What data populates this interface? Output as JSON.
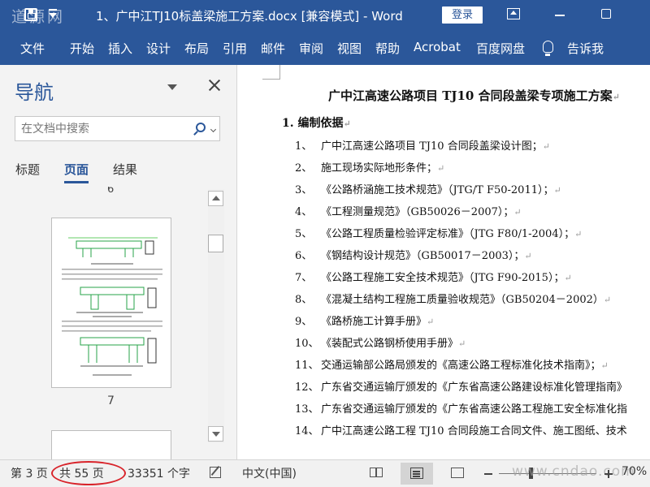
{
  "window": {
    "watermark": "道源网",
    "title": "1、广中江TJ10标盖梁施工方案.docx [兼容模式]  -  Word",
    "login_label": "登录"
  },
  "ribbon": {
    "tabs": [
      "文件",
      "开始",
      "插入",
      "设计",
      "布局",
      "引用",
      "邮件",
      "审阅",
      "视图",
      "帮助",
      "Acrobat",
      "百度网盘"
    ],
    "tell_me": "告诉我"
  },
  "nav": {
    "title": "导航",
    "search_placeholder": "在文档中搜索",
    "tabs": [
      "标题",
      "页面",
      "结果"
    ],
    "active_tab": "页面",
    "page_above": "6",
    "page_label": "7"
  },
  "document": {
    "title": "广中江高速公路项目 TJ10 合同段盖梁专项施工方案",
    "heading": "1. 编制依据",
    "items": [
      {
        "num": "1、",
        "text": "广中江高速公路项目 TJ10 合同段盖梁设计图；"
      },
      {
        "num": "2、",
        "text": "施工现场实际地形条件；"
      },
      {
        "num": "3、",
        "text": "《公路桥涵施工技术规范》（JTG/T F50-2011）；"
      },
      {
        "num": "4、",
        "text": "《工程测量规范》（GB50026－2007）；"
      },
      {
        "num": "5、",
        "text": "《公路工程质量检验评定标准》（JTG F80/1-2004）；"
      },
      {
        "num": "6、",
        "text": "《钢结构设计规范》（GB50017－2003）；"
      },
      {
        "num": "7、",
        "text": "《公路工程施工安全技术规范》（JTG F90-2015）；"
      },
      {
        "num": "8、",
        "text": "《混凝土结构工程施工质量验收规范》（GB50204－2002）"
      },
      {
        "num": "9、",
        "text": "《路桥施工计算手册》"
      },
      {
        "num": "10、",
        "text": "《装配式公路钢桥使用手册》"
      },
      {
        "num": "11、",
        "text": "交通运输部公路局颁发的《高速公路工程标准化技术指南》；"
      },
      {
        "num": "12、",
        "text": "广东省交通运输厅颁发的《广东省高速公路建设标准化管理指南》"
      },
      {
        "num": "13、",
        "text": "广东省交通运输厅颁发的《广东省高速公路工程施工安全标准化指"
      },
      {
        "num": "14、",
        "text": "广中江高速公路工程 TJ10 合同段施工合同文件、施工图纸、技术"
      }
    ]
  },
  "status": {
    "page": "第 3 页",
    "total_pages": "共 55 页",
    "word_count": "33351 个字",
    "language": "中文(中国)",
    "zoom": "70%",
    "site_watermark": "www.cndao.com"
  },
  "colors": {
    "word_blue": "#2b579a",
    "annotation_red": "#d8232a"
  }
}
